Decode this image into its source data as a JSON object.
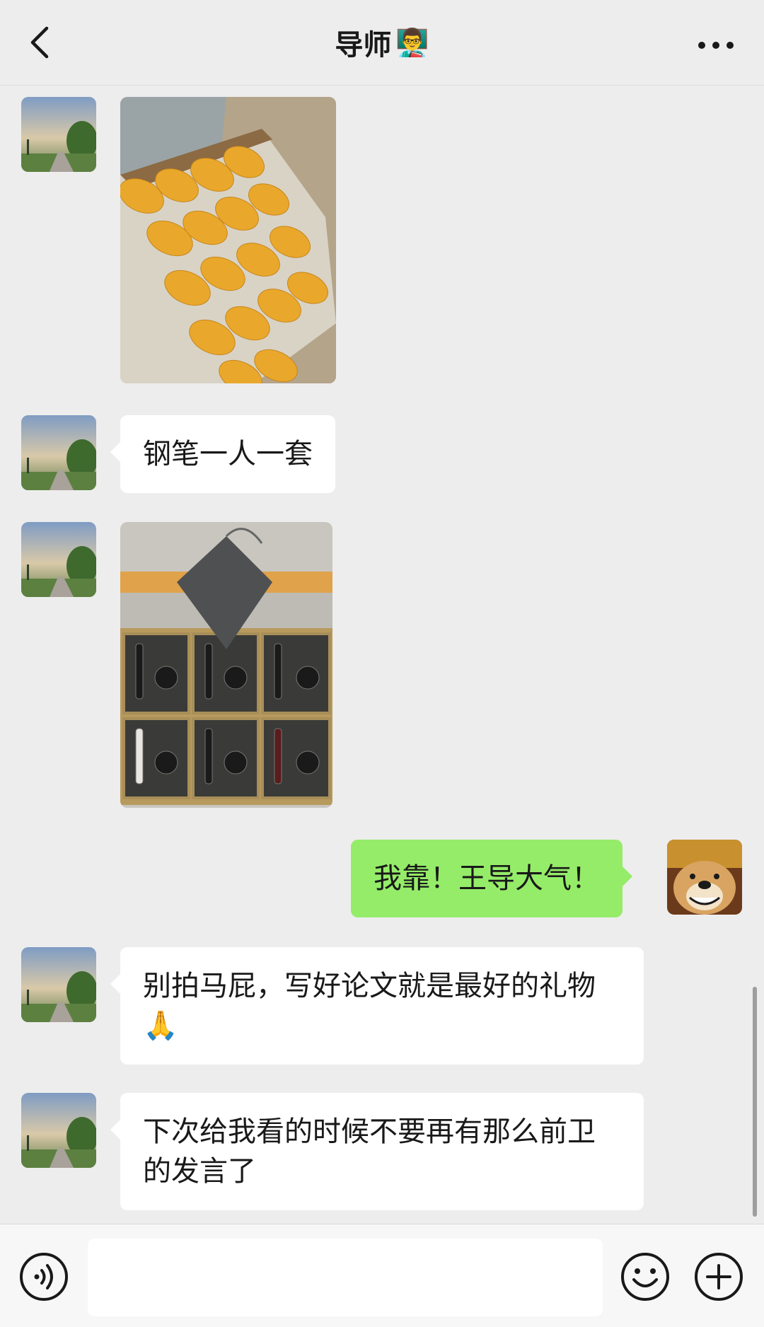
{
  "header": {
    "title": "导师",
    "title_emoji": "👨‍🏫"
  },
  "messages": [
    {
      "type": "image",
      "side": "left",
      "content": "mango-box-photo"
    },
    {
      "type": "text",
      "side": "left",
      "text": "钢笔一人一套"
    },
    {
      "type": "image",
      "side": "left",
      "content": "fountain-pen-gift-sets-photo"
    },
    {
      "type": "text",
      "side": "right",
      "text": "我靠！王导大气！"
    },
    {
      "type": "text",
      "side": "left",
      "text": "别拍马屁，写好论文就是最好的礼物🙏"
    },
    {
      "type": "text",
      "side": "left",
      "text": "下次给我看的时候不要再有那么前卫的发言了"
    }
  ],
  "icons": {
    "back": "chevron-left-icon",
    "more": "more-dots-icon",
    "voice": "voice-icon",
    "emoji": "emoji-smile-icon",
    "plus": "plus-icon"
  },
  "colors": {
    "background": "#ededed",
    "bubble_self": "#95ec69",
    "bubble_other": "#ffffff"
  }
}
